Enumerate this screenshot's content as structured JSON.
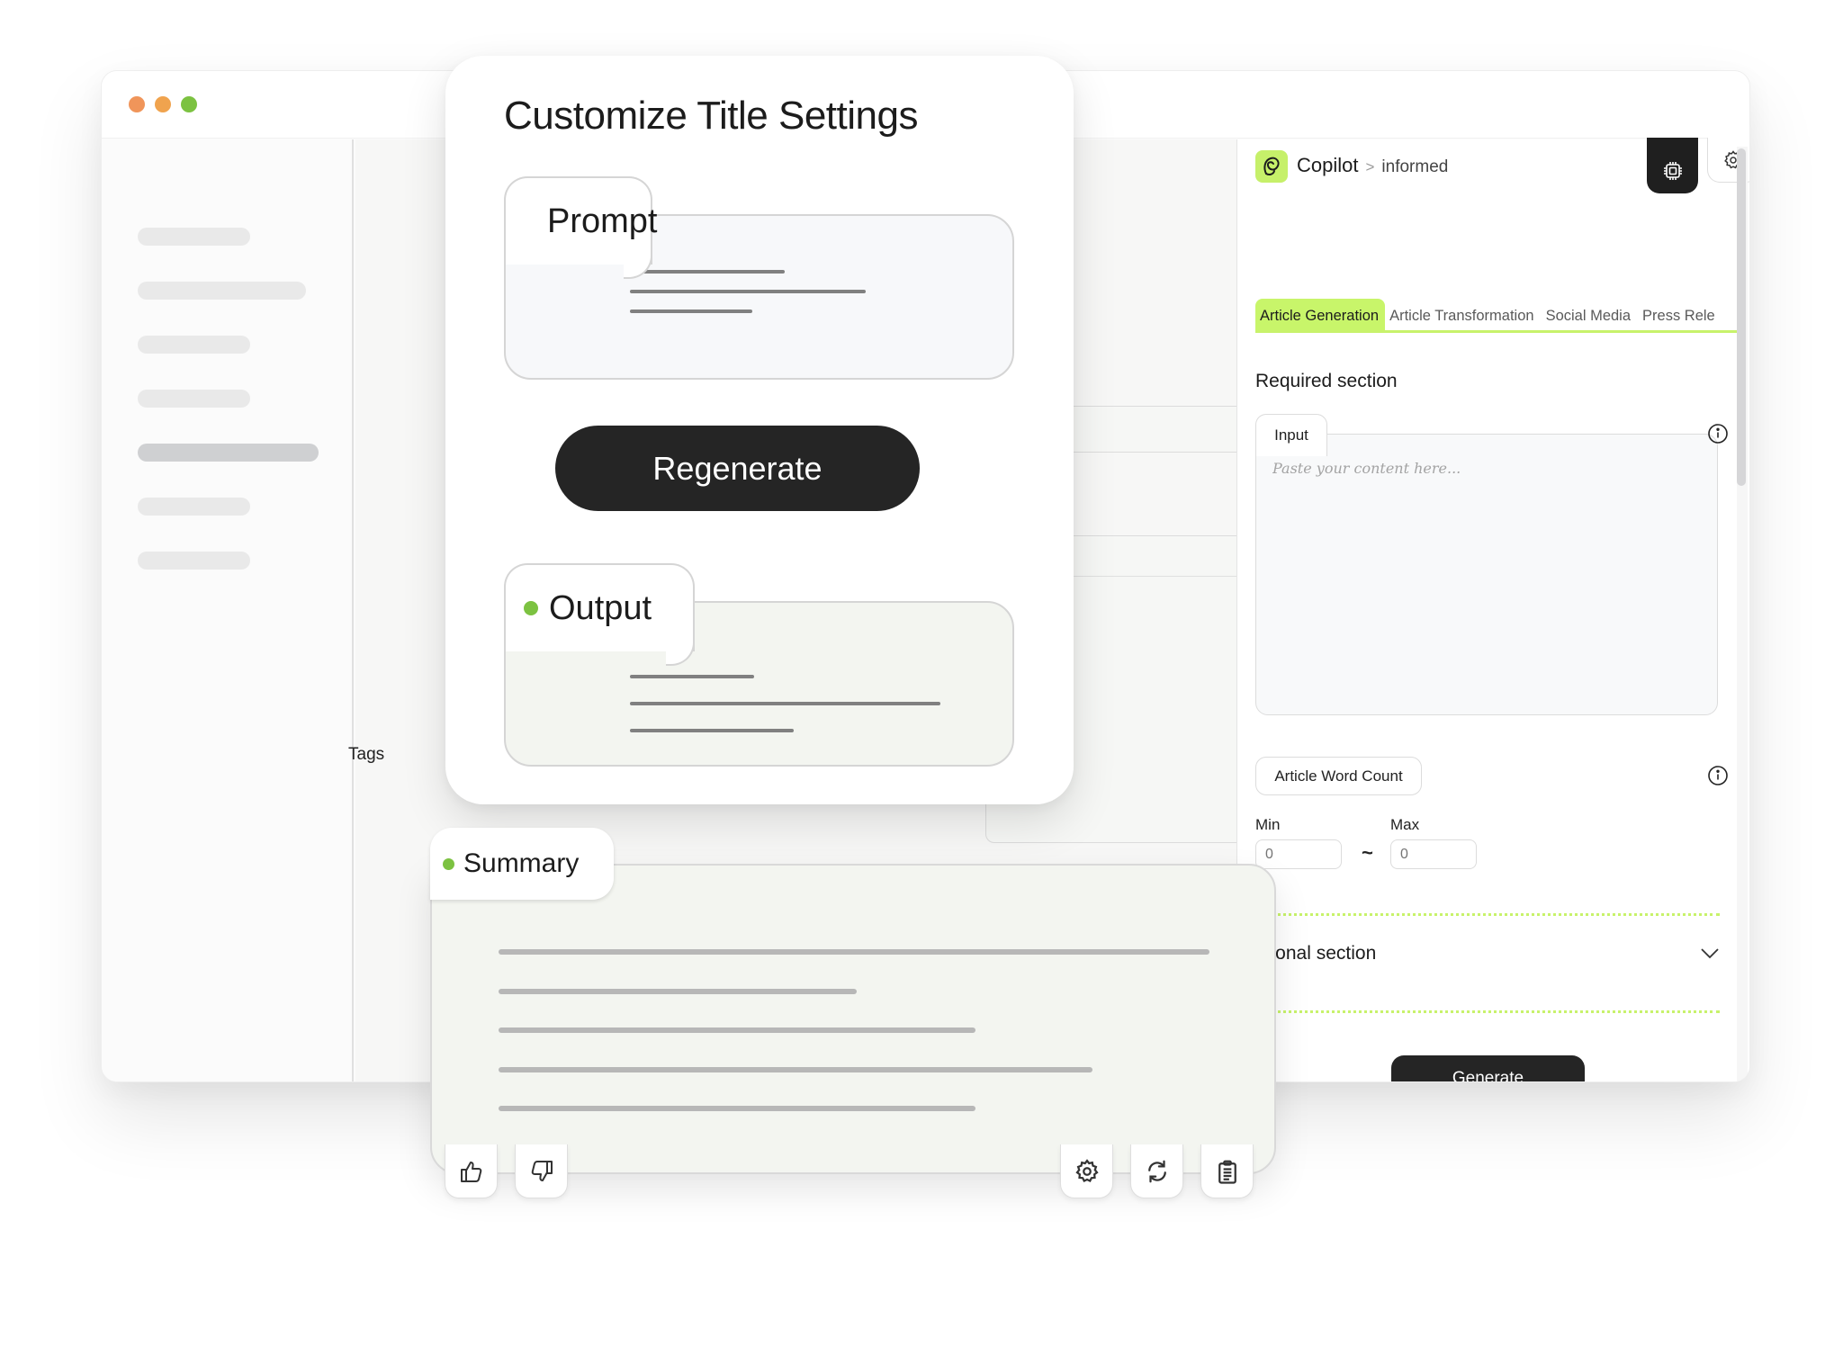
{
  "window": {
    "traffic_lights": [
      "close",
      "minimize",
      "maximize"
    ],
    "sidebar_item_count": 7,
    "active_sidebar_index": 4,
    "tags_label": "Tags"
  },
  "modal": {
    "title": "Customize Title Settings",
    "prompt_label": "Prompt",
    "regenerate_label": "Regenerate",
    "output_label": "Output"
  },
  "summary": {
    "label": "Summary",
    "actions": [
      "thumbs-up",
      "thumbs-down",
      "settings",
      "regenerate",
      "copy"
    ]
  },
  "copilot": {
    "brand": "Copilot",
    "breadcrumb_sep": ">",
    "breadcrumb": "informed",
    "tabs": [
      {
        "label": "Article Generation",
        "active": true
      },
      {
        "label": "Article Transformation",
        "active": false
      },
      {
        "label": "Social Media",
        "active": false
      },
      {
        "label": "Press Rele",
        "active": false
      }
    ],
    "required_section": "Required section",
    "input_label": "Input",
    "input_placeholder": "Paste your content here...",
    "input_value": "",
    "word_count_label": "Article Word Count",
    "min_label": "Min",
    "max_label": "Max",
    "min_placeholder": "0",
    "max_placeholder": "0",
    "range_sep": "~",
    "optional_section": "ptional section",
    "generate_label": "Generate"
  },
  "colors": {
    "accent_green": "#c8f56a",
    "dot_green": "#7cc241",
    "dark_button": "#252525",
    "traffic_red": "#f0955a",
    "traffic_yellow": "#f0a34e",
    "traffic_green": "#7cc241"
  }
}
